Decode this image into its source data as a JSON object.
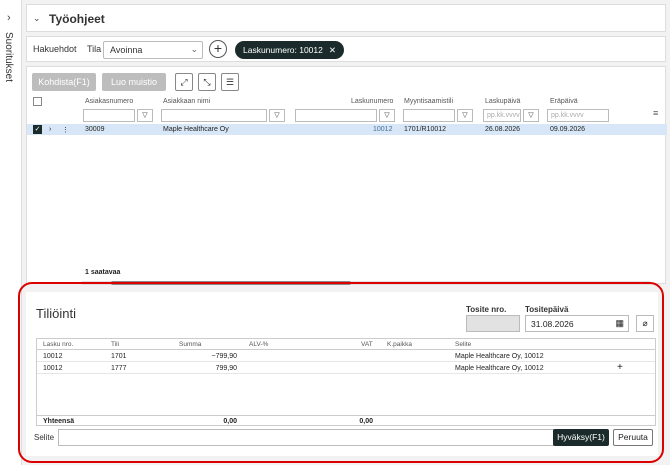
{
  "sidebar": {
    "label": "Suoritukset"
  },
  "header": {
    "title": "Työohjeet"
  },
  "filters": {
    "hakuehdot_label": "Hakuehdot",
    "tila_label": "Tila",
    "tila_value": "Avoinna",
    "chip_label": "Laskunumero: 10012",
    "chip_close": "✕",
    "add_glyph": "+"
  },
  "toolbar": {
    "kohdista_label": "Kohdista(F1)",
    "muistio_label": "Luo muistio"
  },
  "grid": {
    "columns": [
      "Asiakasnumero",
      "Asiakkaan nimi",
      "Laskunumero",
      "Myyntisaamistili",
      "Laskupäivä",
      "Eräpäivä"
    ],
    "date_placeholder": "pp.kk.vvvv",
    "row": {
      "asiakasnumero": "30009",
      "asiakkaan_nimi": "Maple Healthcare Oy",
      "laskunumero": "10012",
      "myyntisaamistili": "1701/R10012",
      "laskupaiva": "26.08.2026",
      "erapaiva": "09.09.2026"
    },
    "count_label": "1 saatavaa"
  },
  "tiliointi": {
    "title": "Tiliöinti",
    "tosite_nro_label": "Tosite nro.",
    "tosite_nro_value": "",
    "tositepaiva_label": "Tositepäivä",
    "tositepaiva_value": "31.08.2026",
    "columns": [
      "Lasku nro.",
      "Tili",
      "Summa",
      "ALV-%",
      "VAT",
      "K.paikka",
      "Selite"
    ],
    "rows": [
      {
        "lasku": "10012",
        "tili": "1701",
        "summa": "−799,90",
        "selite": "Maple Healthcare Oy, 10012"
      },
      {
        "lasku": "10012",
        "tili": "1777",
        "summa": "799,90",
        "selite": "Maple Healthcare Oy, 10012"
      }
    ],
    "total_label": "Yhteensä",
    "total_summa": "0,00",
    "total_vat": "0,00",
    "selite_label": "Selite",
    "hyvaksy_label": "Hyväksy(F1)",
    "peruuta_label": "Peruuta",
    "add_row_glyph": "+"
  },
  "colors": {
    "accent": "#1b2b2b",
    "selected_row": "#d7e7f7",
    "highlight_border": "#dd0000"
  }
}
